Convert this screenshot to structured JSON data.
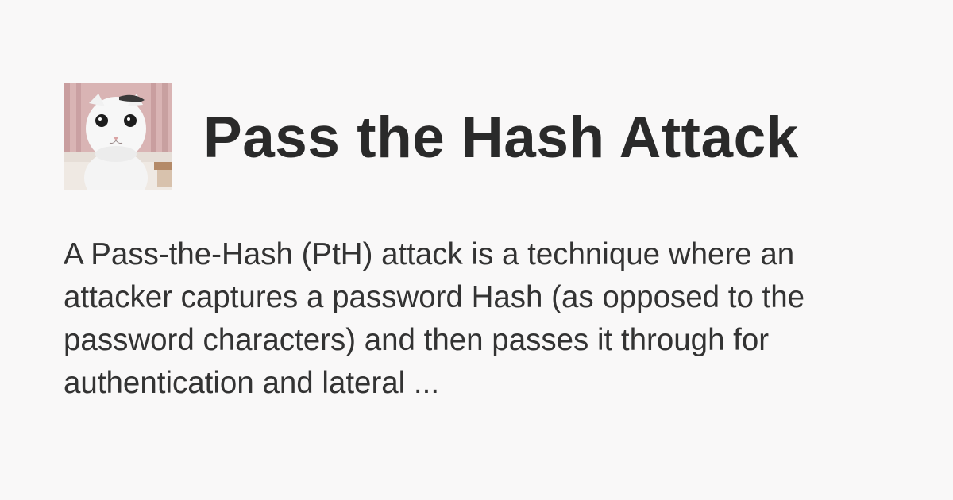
{
  "card": {
    "avatar_icon": "white-cat-photo",
    "title": "Pass the Hash Attack",
    "description": "A Pass-the-Hash (PtH) attack is a technique where an attacker captures a password Hash (as opposed to the password characters) and then passes it through for authentication and lateral ..."
  },
  "colors": {
    "background": "#f9f8f8",
    "title": "#2a2a2a",
    "text": "#333333"
  }
}
